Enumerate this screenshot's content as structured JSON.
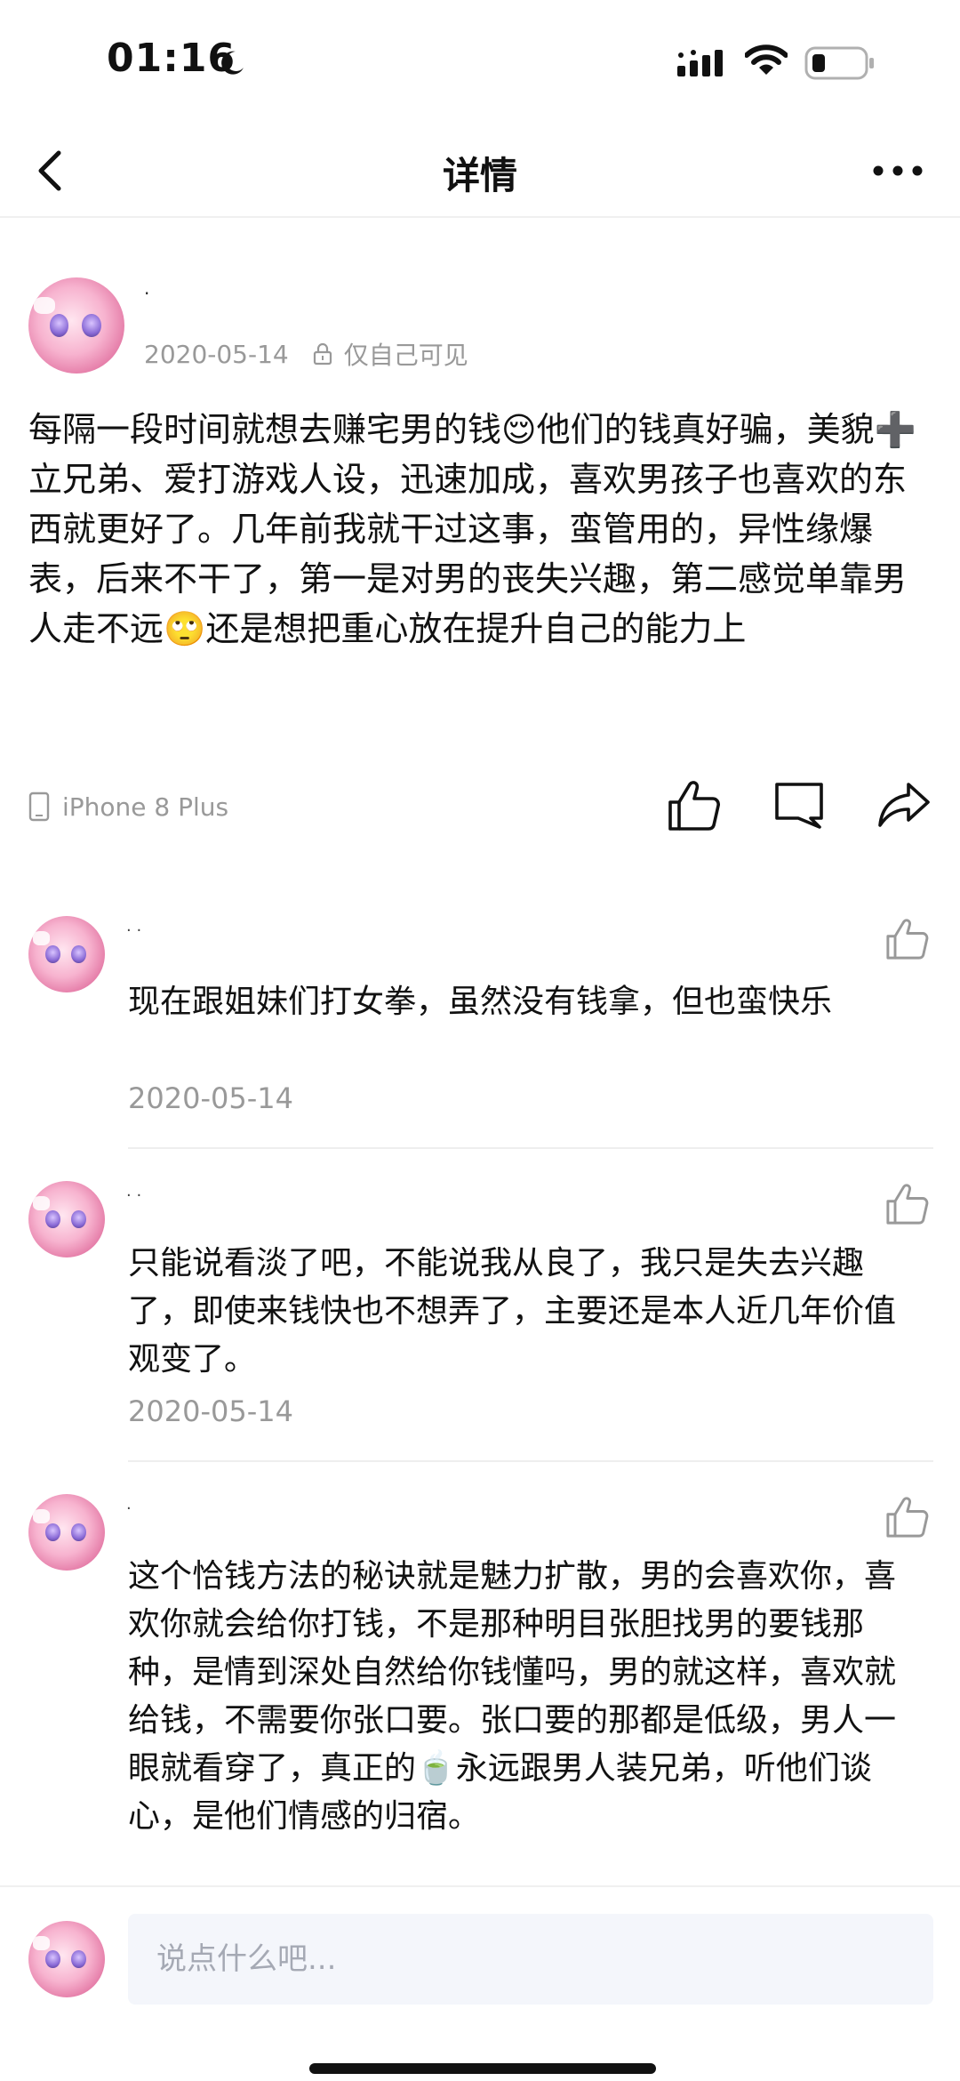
{
  "status_bar": {
    "time": "01:16",
    "icons": [
      "moon-icon",
      "signal-icon",
      "wifi-icon",
      "battery-icon"
    ]
  },
  "nav": {
    "title": "详情",
    "icons": [
      "back-icon",
      "more-icon"
    ]
  },
  "post": {
    "username": "·",
    "date": "2020-05-14",
    "visibility": "仅自己可见",
    "text": "每隔一段时间就想去赚宅男的钱😌他们的钱真好骗，美貌➕立兄弟、爱打游戏人设，迅速加成，喜欢男孩子也喜欢的东西就更好了。几年前我就干过这事，蛮管用的，异性缘爆表，后来不干了，第一是对男的丧失兴趣，第二感觉单靠男人走不远🙄还是想把重心放在提升自己的能力上",
    "device": "iPhone 8 Plus"
  },
  "comments": [
    {
      "username": "· ·",
      "text": "现在跟姐妹们打女拳，虽然没有钱拿，但也蛮快乐",
      "date": "2020-05-14"
    },
    {
      "username": "· ·",
      "text": "只能说看淡了吧，不能说我从良了，我只是失去兴趣了，即使来钱快也不想弄了，主要还是本人近几年价值观变了。",
      "date": "2020-05-14"
    },
    {
      "username": "·",
      "text": "这个恰钱方法的秘诀就是魅力扩散，男的会喜欢你，喜欢你就会给你打钱，不是那种明目张胆找男的要钱那种，是情到深处自然给你钱懂吗，男的就这样，喜欢就给钱，不需要你张口要。张口要的那都是低级，男人一眼就看穿了，真正的🍵永远跟男人装兄弟，听他们谈心，是他们情感的归宿。"
    }
  ],
  "input": {
    "placeholder": "说点什么吧..."
  },
  "colors": {
    "muted_text": "#999999",
    "input_bg": "#f4f6fb",
    "divider": "#eeeeee"
  }
}
